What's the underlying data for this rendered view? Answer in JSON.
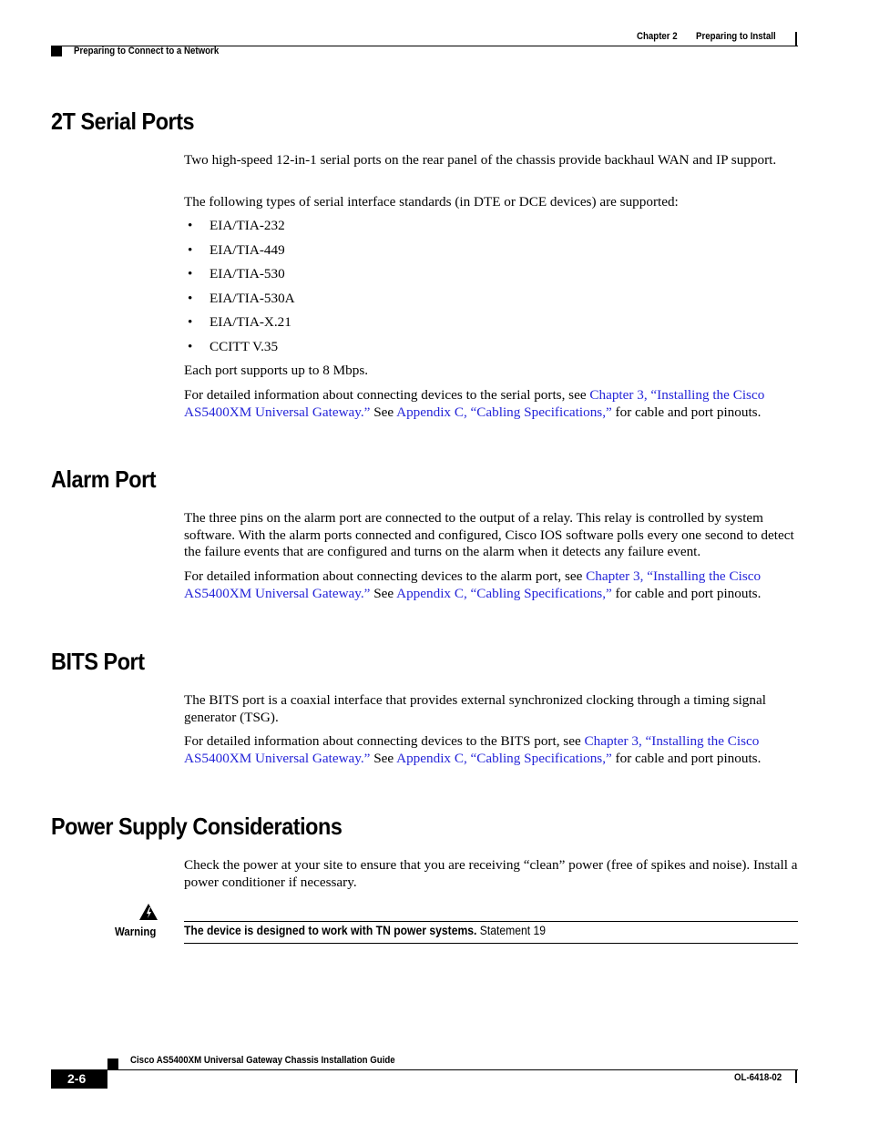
{
  "header": {
    "chapter": "Chapter 2",
    "chapter_title": "Preparing to Install",
    "section": "Preparing to Connect to a Network"
  },
  "sections": {
    "serial": {
      "title": "2T Serial Ports",
      "intro": "Two high-speed 12-in-1 serial ports on the rear panel of the chassis provide backhaul WAN and IP support.",
      "list_intro": "The following types of serial interface standards (in DTE or DCE devices) are supported:",
      "items": [
        "EIA/TIA-232",
        "EIA/TIA-449",
        "EIA/TIA-530",
        "EIA/TIA-530A",
        "EIA/TIA-X.21",
        "CCITT V.35"
      ],
      "speed": "Each port supports up to 8 Mbps.",
      "ref_pre": "For detailed information about connecting devices to the serial ports, see ",
      "ref_link1": "Chapter 3, “Installing the Cisco AS5400XM Universal Gateway.”",
      "ref_mid": " See ",
      "ref_link2": "Appendix C, “Cabling Specifications,”",
      "ref_post": " for cable and port pinouts."
    },
    "alarm": {
      "title": "Alarm Port",
      "body": "The three pins on the alarm port are connected to the output of a relay. This relay is controlled by system software. With the alarm ports connected and configured, Cisco IOS software polls every one second to detect the failure events that are configured and turns on the alarm when it detects any failure event.",
      "ref_pre": "For detailed information about connecting devices to the alarm port, see ",
      "ref_link1": "Chapter 3, “Installing the Cisco AS5400XM Universal Gateway.”",
      "ref_mid": " See ",
      "ref_link2": "Appendix C, “Cabling Specifications,”",
      "ref_post": " for cable and port pinouts."
    },
    "bits": {
      "title": "BITS Port",
      "body": "The BITS port is a coaxial interface that provides external synchronized clocking through a timing signal generator (TSG).",
      "ref_pre": "For detailed information about connecting devices to the BITS port, see ",
      "ref_link1": "Chapter 3, “Installing the Cisco AS5400XM Universal Gateway.”",
      "ref_mid": " See ",
      "ref_link2": "Appendix C, “Cabling Specifications,”",
      "ref_post": " for cable and port pinouts."
    },
    "power": {
      "title": "Power Supply Considerations",
      "body": "Check the power at your site to ensure that you are receiving “clean” power (free of spikes and noise). Install a power conditioner if necessary."
    }
  },
  "warning": {
    "label": "Warning",
    "bold_text": "The device is designed to work with TN power systems.",
    "statement": " Statement 19"
  },
  "footer": {
    "guide_title": "Cisco AS5400XM Universal Gateway Chassis Installation Guide",
    "page_number": "2-6",
    "doc_id": "OL-6418-02"
  },
  "colors": {
    "link": "#2424d8"
  }
}
